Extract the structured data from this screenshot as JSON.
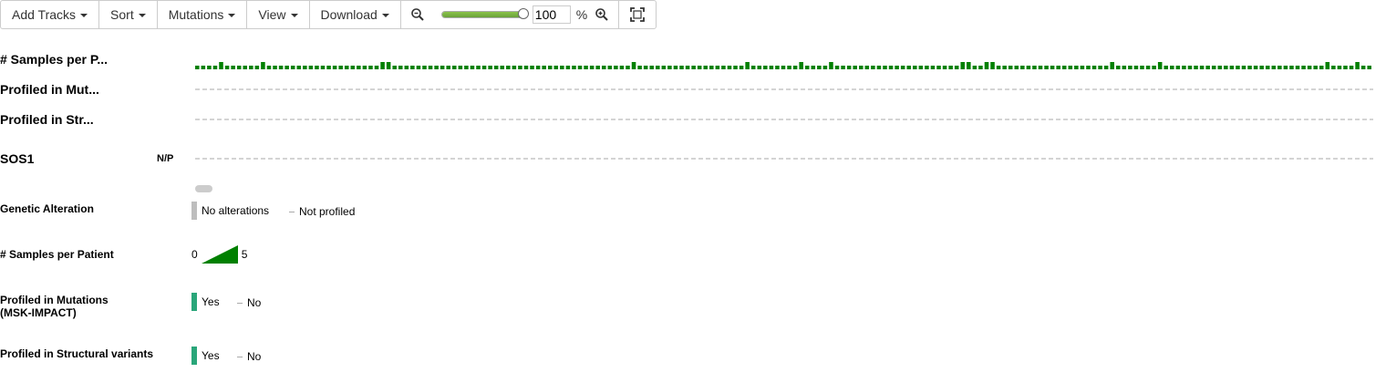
{
  "toolbar": {
    "add_tracks": "Add Tracks",
    "sort": "Sort",
    "mutations": "Mutations",
    "view": "View",
    "download": "Download",
    "zoom_value": "100",
    "zoom_unit": "%",
    "zoom_level": 1.0
  },
  "tracks": [
    {
      "label": "# Samples per P...",
      "type": "bars"
    },
    {
      "label": "Profiled in Mut...",
      "type": "dashed"
    },
    {
      "label": "Profiled in Str...",
      "type": "dashed"
    },
    {
      "label": "SOS1",
      "type": "dashed",
      "annotation": "N/P"
    }
  ],
  "samples_per_patient": [
    1,
    1,
    1,
    1,
    2,
    1,
    1,
    1,
    1,
    1,
    1,
    2,
    1,
    1,
    1,
    1,
    1,
    1,
    1,
    1,
    1,
    1,
    1,
    1,
    1,
    1,
    1,
    1,
    1,
    1,
    1,
    2,
    2,
    1,
    1,
    1,
    1,
    1,
    1,
    1,
    1,
    1,
    1,
    1,
    1,
    1,
    1,
    1,
    1,
    1,
    1,
    1,
    1,
    1,
    1,
    1,
    1,
    1,
    1,
    1,
    1,
    1,
    1,
    1,
    1,
    1,
    1,
    1,
    1,
    1,
    1,
    1,
    1,
    2,
    1,
    1,
    1,
    1,
    1,
    1,
    1,
    1,
    1,
    1,
    1,
    1,
    1,
    1,
    1,
    1,
    1,
    1,
    2,
    1,
    1,
    1,
    1,
    1,
    1,
    1,
    1,
    2,
    1,
    1,
    1,
    1,
    2,
    1,
    1,
    1,
    1,
    1,
    1,
    1,
    1,
    1,
    1,
    1,
    1,
    1,
    1,
    1,
    1,
    1,
    1,
    1,
    1,
    1,
    2,
    2,
    1,
    1,
    2,
    2,
    1,
    1,
    1,
    1,
    1,
    1,
    1,
    1,
    1,
    1,
    1,
    1,
    1,
    1,
    1,
    1,
    1,
    1,
    1,
    2,
    1,
    1,
    1,
    1,
    1,
    1,
    1,
    2,
    1,
    1,
    1,
    1,
    1,
    1,
    1,
    1,
    1,
    1,
    1,
    1,
    1,
    1,
    1,
    1,
    1,
    1,
    1,
    1,
    1,
    1,
    1,
    1,
    1,
    1,
    1,
    2,
    1,
    1,
    1,
    1,
    2,
    1,
    1
  ],
  "legend": {
    "genetic_alteration": {
      "label": "Genetic Alteration",
      "no_alterations": "No alterations",
      "not_profiled": "Not profiled"
    },
    "samples_per_patient": {
      "label": "# Samples per Patient",
      "min": "0",
      "max": "5"
    },
    "profiled_mutations": {
      "label": "Profiled in Mutations (MSK-IMPACT)",
      "yes": "Yes",
      "no": "No"
    },
    "profiled_structural": {
      "label": "Profiled in Structural variants",
      "yes": "Yes",
      "no": "No"
    }
  },
  "colors": {
    "bar": "#008000",
    "profiled": "#2aa67a",
    "no_alteration": "#bebebe",
    "dashed": "#aaaaaa"
  }
}
